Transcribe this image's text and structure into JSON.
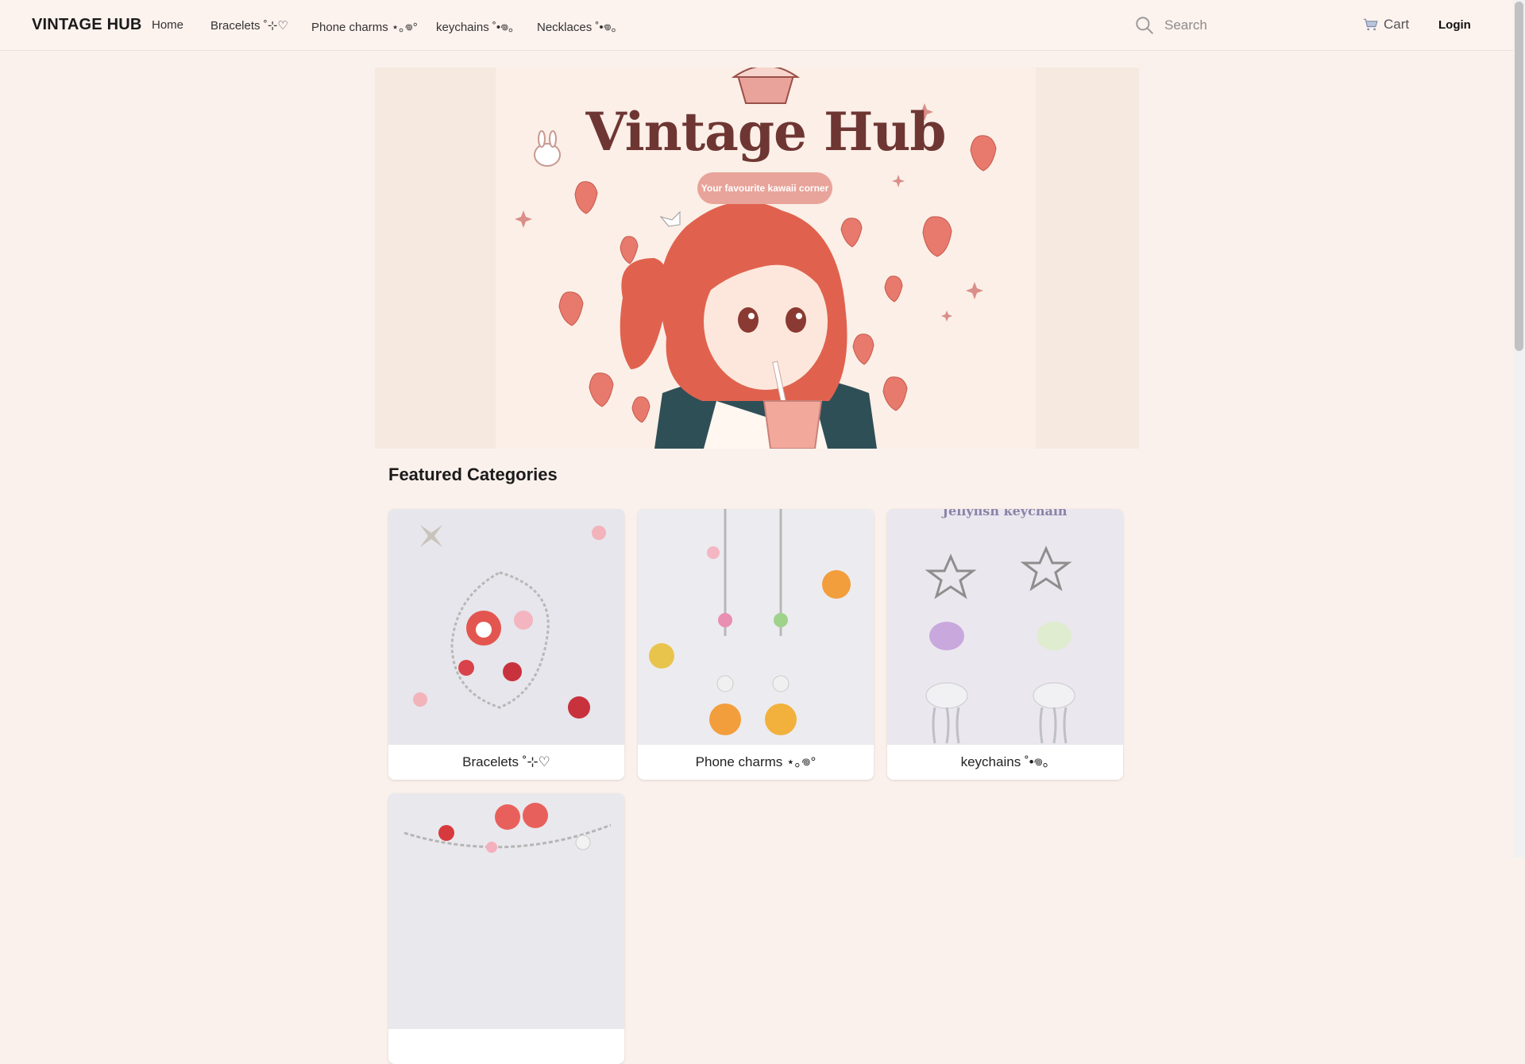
{
  "header": {
    "brand": "VINTAGE HUB",
    "nav": [
      {
        "label": "Home"
      },
      {
        "label": "Bracelets ˚⊹♡"
      },
      {
        "label": "Phone charms ⋆｡𖦹°"
      },
      {
        "label": "keychains ˚•𖦹｡"
      },
      {
        "label": "Necklaces ˚•𖦹｡"
      }
    ],
    "search_placeholder": "Search",
    "cart_label": "Cart",
    "login_label": "Login"
  },
  "hero": {
    "title": "Vintage Hub",
    "tagline": "Your favourite kawaii corner"
  },
  "featured": {
    "title": "Featured Categories",
    "categories": [
      {
        "label": "Bracelets ˚⊹♡",
        "image_caption": ""
      },
      {
        "label": "Phone charms ⋆｡𖦹°",
        "image_caption": ""
      },
      {
        "label": "keychains ˚•𖦹｡",
        "image_caption": "Jellyfish keychain"
      }
    ]
  },
  "colors": {
    "page_bg": "#fbf1ec",
    "hero_title": "#6e3633",
    "hero_pill": "#e8a49a",
    "strawberry": "#e77a6d"
  }
}
